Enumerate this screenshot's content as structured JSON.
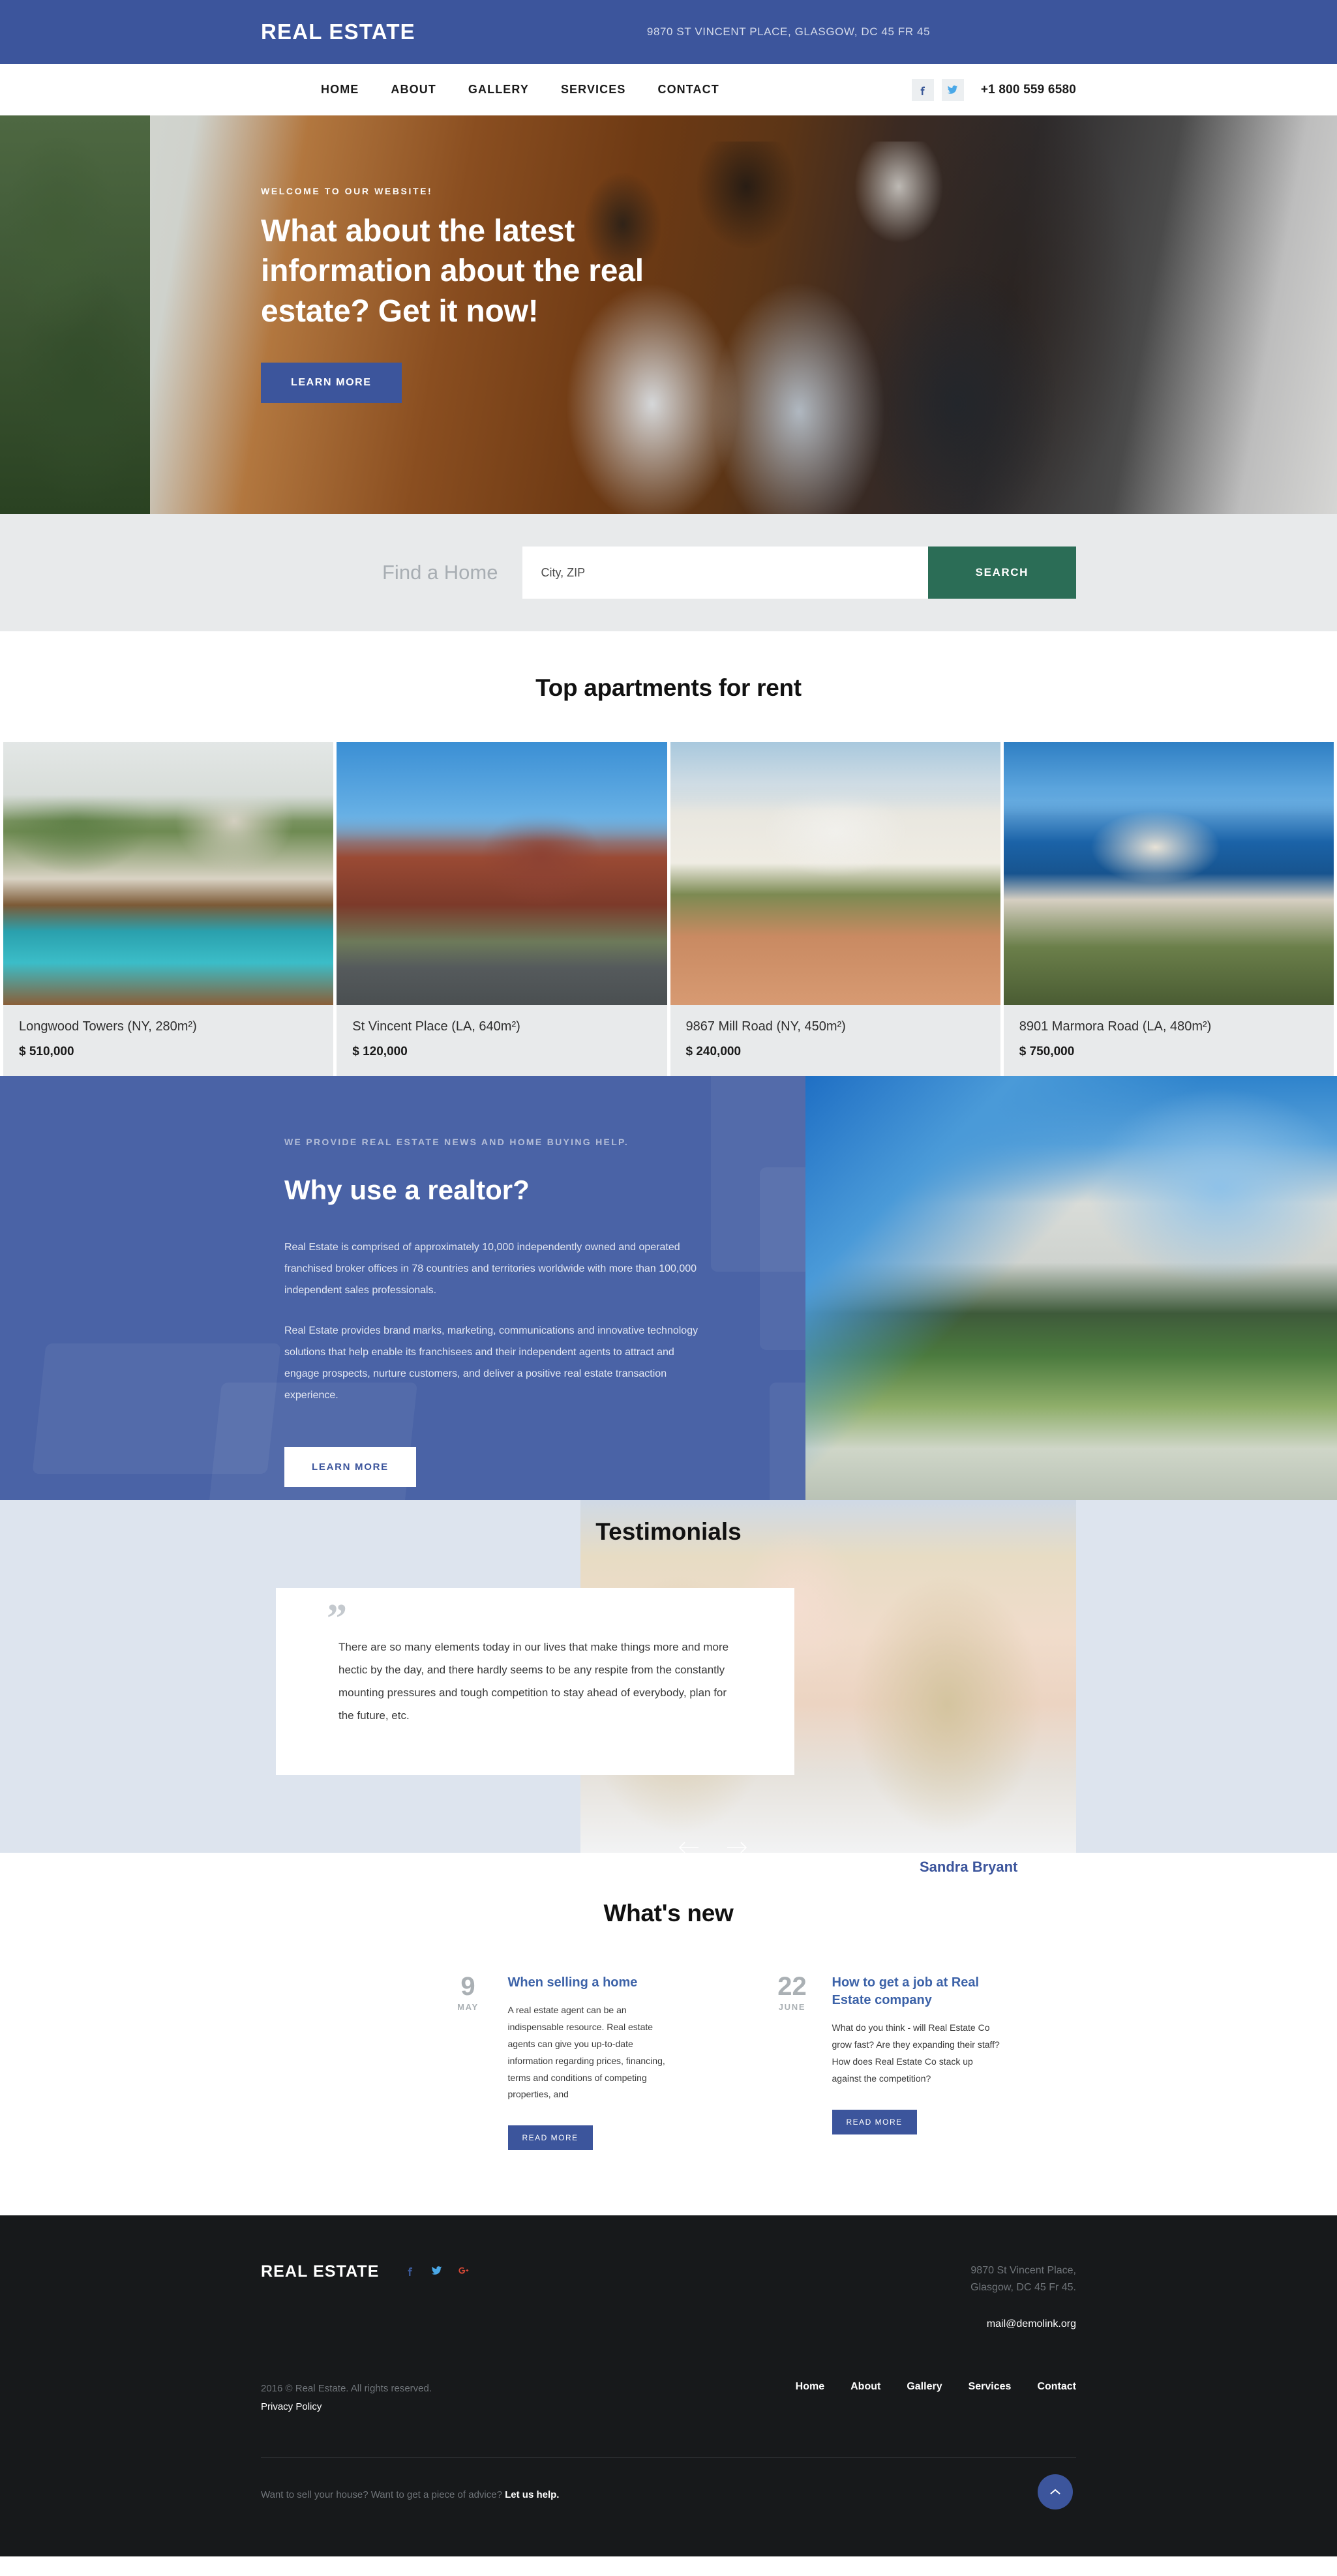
{
  "topbar": {
    "brand": "Real Estate",
    "address": "9870 St Vincent Place, Glasgow, DC 45 FR 45"
  },
  "nav": {
    "items": [
      {
        "label": "Home"
      },
      {
        "label": "About"
      },
      {
        "label": "Gallery"
      },
      {
        "label": "Services"
      },
      {
        "label": "Contact"
      }
    ],
    "social": [
      {
        "name": "facebook-icon"
      },
      {
        "name": "twitter-icon"
      }
    ],
    "phone": "+1 800 559 6580"
  },
  "hero": {
    "eyebrow": "Welcome to our website!",
    "title": "What about the latest information about the real estate? Get it now!",
    "cta": "Learn more",
    "prev": "previous-slide",
    "next": "next-slide"
  },
  "search": {
    "label": "Find a Home",
    "placeholder": "City, ZIP",
    "button": "Search",
    "button_color": "#2b6d56"
  },
  "apartments": {
    "title": "Top apartments for rent",
    "items": [
      {
        "name": "Longwood Towers (NY, 280m²)",
        "price": "$ 510,000"
      },
      {
        "name": "St Vincent Place (LA, 640m²)",
        "price": "$ 120,000"
      },
      {
        "name": "9867 Mill Road (NY, 450m²)",
        "price": "$ 240,000"
      },
      {
        "name": "8901 Marmora Road (LA, 480m²)",
        "price": "$ 750,000"
      }
    ]
  },
  "realtor": {
    "eyebrow": "We provide real estate news and home buying help.",
    "title": "Why use a realtor?",
    "paragraph1": "Real Estate is comprised of approximately 10,000 independently owned and operated franchised broker offices in 78 countries and territories worldwide with more than 100,000 independent sales professionals.",
    "paragraph2": "Real Estate provides brand marks, marketing, communications and innovative technology solutions that help enable its franchisees and their independent agents to attract and engage prospects, nurture customers, and deliver a positive real estate transaction experience.",
    "cta": "Learn more",
    "bg_color": "#4a63a6"
  },
  "testimonials": {
    "title": "Testimonials",
    "quote_mark": "”",
    "text": "There are so many elements today in our lives that make things more and more hectic by the day, and there hardly seems to be any respite from the constantly mounting pressures and tough competition to stay ahead of everybody, plan for the future, etc.",
    "author": "Sandra Bryant",
    "author_color": "#3c559c",
    "prev": "previous-testimonial",
    "next": "next-testimonial"
  },
  "blog": {
    "title": "What's new",
    "posts": [
      {
        "day": "9",
        "month": "May",
        "title": "When selling a home",
        "body": "A real estate agent can be an indispensable resource. Real estate agents can give you up-to-date information regarding prices, financing, terms and conditions of competing properties, and",
        "cta": "Read more"
      },
      {
        "day": "22",
        "month": "June",
        "title": "How to get a job at Real Estate company",
        "body": "What do you think - will Real Estate Co grow fast? Are they expanding their staff? How does Real Estate Co stack up against the competition?",
        "cta": "Read more"
      }
    ]
  },
  "footer": {
    "brand": "Real Estate",
    "social": [
      {
        "name": "facebook-icon"
      },
      {
        "name": "twitter-icon"
      },
      {
        "name": "google-plus-icon"
      }
    ],
    "address_line1": "9870 St Vincent Place,",
    "address_line2": "Glasgow, DC 45 Fr 45.",
    "email": "mail@demolink.org",
    "copyright": "2016 © Real Estate. All rights reserved.",
    "privacy": "Privacy Policy",
    "nav": [
      {
        "label": "Home"
      },
      {
        "label": "About"
      },
      {
        "label": "Gallery"
      },
      {
        "label": "Services"
      },
      {
        "label": "Contact"
      }
    ],
    "cta_text": "Want to sell your house? Want to get a piece of advice?",
    "cta_link": "Let us help.",
    "to_top": "back-to-top"
  }
}
